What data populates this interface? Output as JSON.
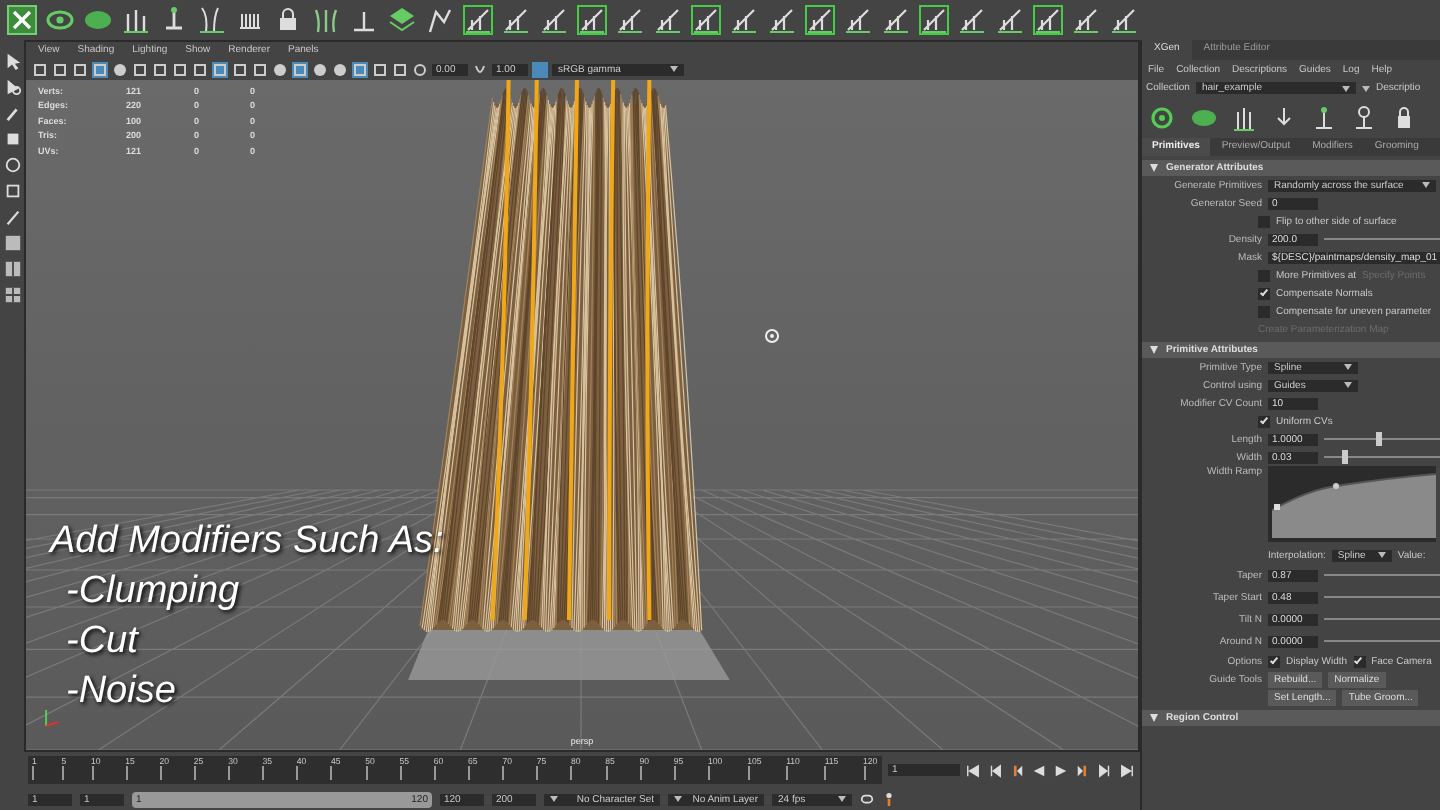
{
  "viewport": {
    "menus": [
      "View",
      "Shading",
      "Lighting",
      "Show",
      "Renderer",
      "Panels"
    ],
    "toolbar_fields": [
      "0.00",
      "1.00"
    ],
    "color_space": "sRGB gamma",
    "hud": [
      {
        "label": "Verts:",
        "values": [
          "121",
          "0",
          "0"
        ]
      },
      {
        "label": "Edges:",
        "values": [
          "220",
          "0",
          "0"
        ]
      },
      {
        "label": "Faces:",
        "values": [
          "100",
          "0",
          "0"
        ]
      },
      {
        "label": "Tris:",
        "values": [
          "200",
          "0",
          "0"
        ]
      },
      {
        "label": "UVs:",
        "values": [
          "121",
          "0",
          "0"
        ]
      }
    ],
    "caption": {
      "title": "Add Modifiers Such As:",
      "items": [
        "-Clumping",
        "-Cut",
        "-Noise"
      ]
    },
    "camera": "persp"
  },
  "timeline": {
    "labels": [
      "1",
      "5",
      "10",
      "15",
      "20",
      "25",
      "30",
      "35",
      "40",
      "45",
      "50",
      "55",
      "60",
      "65",
      "70",
      "75",
      "80",
      "85",
      "90",
      "95",
      "100",
      "105",
      "110",
      "115",
      "120"
    ],
    "current_frame": "1"
  },
  "range_bar": {
    "start_fields": [
      "1",
      "1"
    ],
    "level": 1,
    "range_start": "1",
    "range_end": "120",
    "end_fields": [
      "120",
      "200"
    ],
    "character_set": "No Character Set",
    "anim_layer": "No Anim Layer",
    "fps": "24 fps"
  },
  "xgen": {
    "tabs": [
      {
        "label": "XGen",
        "selected": true
      },
      {
        "label": "Attribute Editor",
        "selected": false
      }
    ],
    "menus": [
      "File",
      "Collection",
      "Descriptions",
      "Guides",
      "Log",
      "Help"
    ],
    "collection": {
      "label": "Collection",
      "value": "hair_example",
      "next_label": "Descriptio"
    },
    "subtabs": [
      {
        "label": "Primitives",
        "selected": true
      },
      {
        "label": "Preview/Output",
        "selected": false
      },
      {
        "label": "Modifiers",
        "selected": false
      },
      {
        "label": "Grooming",
        "selected": false
      }
    ],
    "sections": [
      {
        "title": "Generator Attributes",
        "expanded": true,
        "rows": [
          {
            "kind": "dropdown",
            "label": "Generate Primitives",
            "value": "Randomly across the surface"
          },
          {
            "kind": "field",
            "label": "Generator Seed",
            "value": "0"
          },
          {
            "kind": "checkbox",
            "text": "Flip to other side of surface",
            "checked": false
          },
          {
            "kind": "slider",
            "label": "Density",
            "value": "200.0"
          },
          {
            "kind": "field",
            "label": "Mask",
            "value": "${DESC}/paintmaps/density_map_01"
          },
          {
            "kind": "checkbox",
            "text": "More Primitives at",
            "checked": false,
            "extra": "Specify Points"
          },
          {
            "kind": "checkbox",
            "text": "Compensate Normals",
            "checked": true
          },
          {
            "kind": "checkbox",
            "text": "Compensate for uneven parameter",
            "checked": false
          },
          {
            "kind": "action",
            "text": "Create Parameterization Map",
            "disabled": true
          }
        ]
      },
      {
        "title": "Primitive Attributes",
        "expanded": true,
        "rows": [
          {
            "kind": "dropdown",
            "label": "Primitive Type",
            "value": "Spline"
          },
          {
            "kind": "dropdown",
            "label": "Control using",
            "value": "Guides"
          },
          {
            "kind": "field",
            "label": "Modifier CV Count",
            "value": "10"
          },
          {
            "kind": "checkbox",
            "text": "Uniform CVs",
            "checked": true
          },
          {
            "kind": "slider",
            "label": "Length",
            "value": "1.0000",
            "level": 0.45
          },
          {
            "kind": "slider",
            "label": "Width",
            "value": "0.03",
            "level": 0.15
          },
          {
            "kind": "ramp",
            "label": "Width Ramp",
            "interpolation_label": "Interpolation:",
            "interpolation": "Spline",
            "value_label": "Value:"
          },
          {
            "kind": "slider",
            "label": "Taper",
            "value": "0.87"
          },
          {
            "kind": "slider",
            "label": "Taper Start",
            "value": "0.48"
          },
          {
            "kind": "slider",
            "label": "Tilt N",
            "value": "0.0000"
          },
          {
            "kind": "slider",
            "label": "Around N",
            "value": "0.0000"
          },
          {
            "kind": "checks",
            "label": "Options",
            "items": [
              {
                "text": "Display Width",
                "checked": true
              },
              {
                "text": "Face Camera",
                "checked": true
              }
            ]
          },
          {
            "kind": "buttons",
            "label": "Guide Tools",
            "items": [
              "Rebuild...",
              "Normalize"
            ]
          },
          {
            "kind": "buttons",
            "items": [
              "Set Length...",
              "Tube Groom..."
            ]
          }
        ]
      },
      {
        "title": "Region Control",
        "expanded": true
      }
    ]
  }
}
